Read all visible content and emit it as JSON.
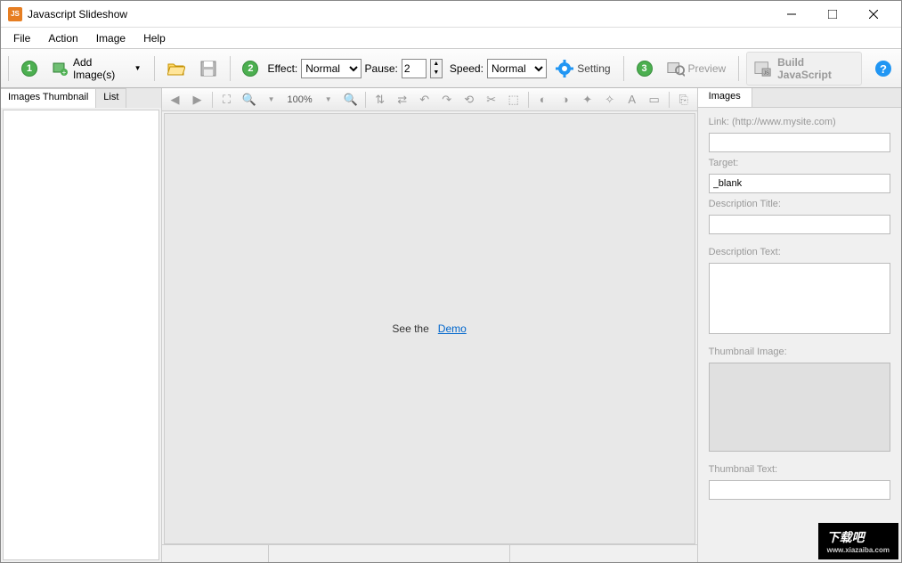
{
  "titlebar": {
    "title": "Javascript Slideshow",
    "app_badge": "JS"
  },
  "menubar": {
    "file": "File",
    "action": "Action",
    "image": "Image",
    "help": "Help"
  },
  "toolbar": {
    "add_images": "Add Image(s)",
    "effect_label": "Effect:",
    "effect_value": "Normal",
    "pause_label": "Pause:",
    "pause_value": "2",
    "speed_label": "Speed:",
    "speed_value": "Normal",
    "setting_label": "Setting",
    "preview_label": "Preview",
    "build_label": "Build JavaScript"
  },
  "left_panel": {
    "tab_thumb": "Images Thumbnail",
    "tab_list": "List"
  },
  "center": {
    "see_the": "See the",
    "demo": "Demo",
    "zoom": "100%"
  },
  "right_panel": {
    "tab": "Images",
    "link_label": "Link: (http://www.mysite.com)",
    "link_value": "",
    "target_label": "Target:",
    "target_value": "_blank",
    "desc_title_label": "Description Title:",
    "desc_title_value": "",
    "desc_text_label": "Description Text:",
    "thumb_img_label": "Thumbnail Image:",
    "thumb_text_label": "Thumbnail Text:",
    "thumb_text_value": ""
  },
  "watermark": {
    "main": "下载吧",
    "sub": "www.xiazaiba.com"
  }
}
